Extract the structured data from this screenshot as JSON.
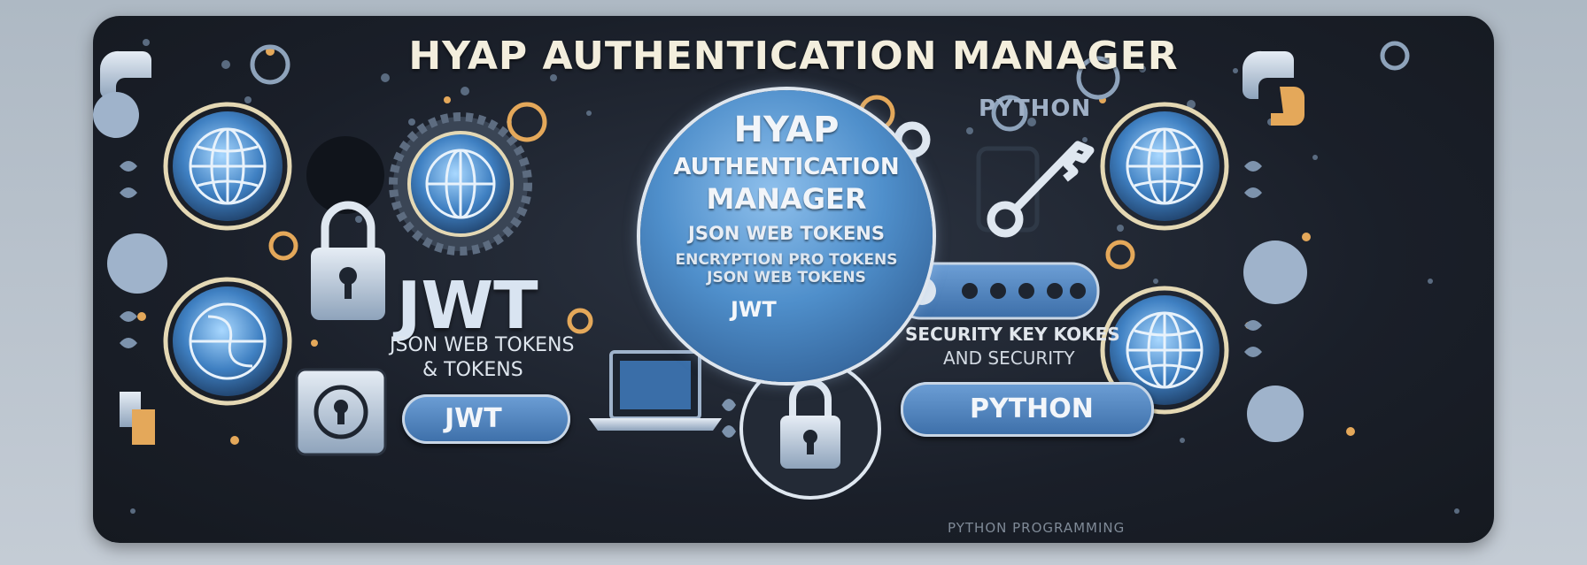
{
  "banner": {
    "title": "HYAP AUTHENTICATION MANAGER",
    "python_top_label": "PYTHON",
    "center_badge": {
      "line1": "HYAP",
      "line2": "AUTHENTICATION",
      "line3": "MANAGER",
      "line4": "JSON WEB TOKENS",
      "line5": "ENCRYPTION PRO TOKENS",
      "line6": "JSON WEB TOKENS",
      "line7": "JWT"
    },
    "jwt_block": {
      "heading": "JWT",
      "sub1": "JSON WEB TOKENS",
      "sub2": "& TOKENS"
    },
    "security_block": {
      "line1": "SECURITY KEY KOKES",
      "line2": "AND SECURITY"
    },
    "pill_jwt_label": "JWT",
    "pill_python_label": "PYTHON",
    "footer_text": "PYTHON PROGRAMMING"
  },
  "icons": [
    "globe-icon",
    "lock-icon",
    "key-icon",
    "python-logo-icon",
    "laptop-icon",
    "leaf-icon",
    "gear-icon",
    "keyhole-icon",
    "password-field-icon"
  ],
  "colors": {
    "background": "#1a1f29",
    "accent_blue": "#4f8fcb",
    "accent_gold": "#e4a85a",
    "text_light": "#f3eedd"
  }
}
